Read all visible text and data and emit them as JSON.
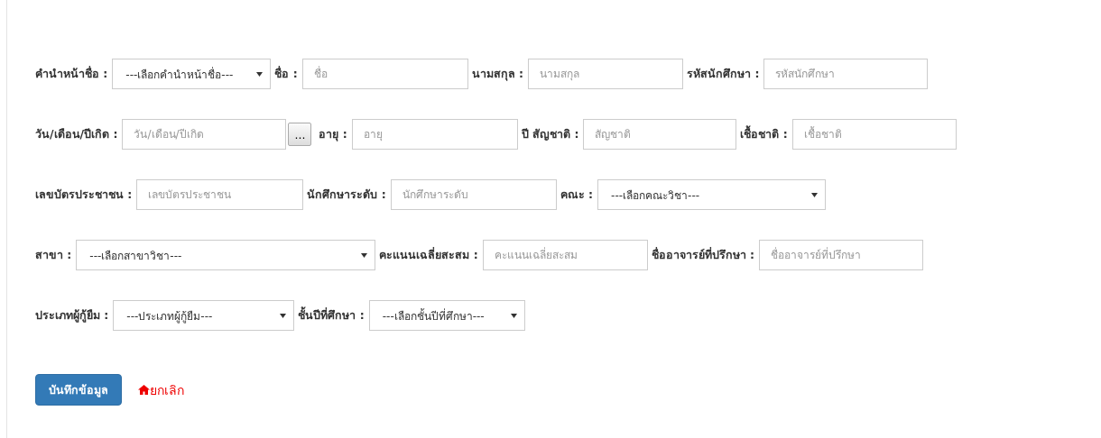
{
  "rows": [
    {
      "fields": [
        {
          "kind": "select",
          "label": "คำนำหน้าชื่อ :",
          "value": "---เลือกคำนำหน้าชื่อ---"
        },
        {
          "kind": "text",
          "label": "ชื่อ :",
          "placeholder": "ชื่อ"
        },
        {
          "kind": "text",
          "label": "นามสกุล :",
          "placeholder": "นามสกุล"
        },
        {
          "kind": "text",
          "label": "รหัสนักศึกษา :",
          "placeholder": "รหัสนักศึกษา"
        }
      ]
    },
    {
      "fields": [
        {
          "kind": "date",
          "label": "วัน/เดือน/ปีเกิด :",
          "placeholder": "วัน/เดือน/ปีเกิด",
          "button": "..."
        },
        {
          "kind": "text",
          "label": "อายุ :",
          "placeholder": "อายุ"
        },
        {
          "kind": "text",
          "label": "ปี สัญชาติ :",
          "placeholder": "สัญชาติ"
        },
        {
          "kind": "text",
          "label": "เชื้อชาติ :",
          "placeholder": "เชื้อชาติ"
        }
      ]
    },
    {
      "fields": [
        {
          "kind": "text",
          "label": "เลขบัตรประชาชน :",
          "placeholder": "เลขบัตรประชาชน"
        },
        {
          "kind": "text",
          "label": "นักศึกษาระดับ :",
          "placeholder": "นักศึกษาระดับ"
        },
        {
          "kind": "select",
          "label": "คณะ :",
          "value": "---เลือกคณะวิชา---"
        }
      ]
    },
    {
      "fields": [
        {
          "kind": "select",
          "label": "สาขา :",
          "value": "---เลือกสาขาวิชา---"
        },
        {
          "kind": "text",
          "label": "คะแนนเฉลี่ยสะสม :",
          "placeholder": "คะแนนเฉลี่ยสะสม"
        },
        {
          "kind": "text",
          "label": "ชื่ออาจารย์ที่ปรึกษา :",
          "placeholder": "ชื่ออาจารย์ที่ปรึกษา"
        }
      ]
    },
    {
      "fields": [
        {
          "kind": "select",
          "label": "ประเภทผู้กู้ยืม :",
          "value": "---ประเภทผู้กู้ยืม---"
        },
        {
          "kind": "select",
          "label": "ชั้นปีที่ศึกษา :",
          "value": "---เลือกชั้นปีที่ศึกษา---"
        }
      ]
    }
  ],
  "actions": {
    "save": "บันทึกข้อมูล",
    "cancel": "ยกเลิก"
  }
}
